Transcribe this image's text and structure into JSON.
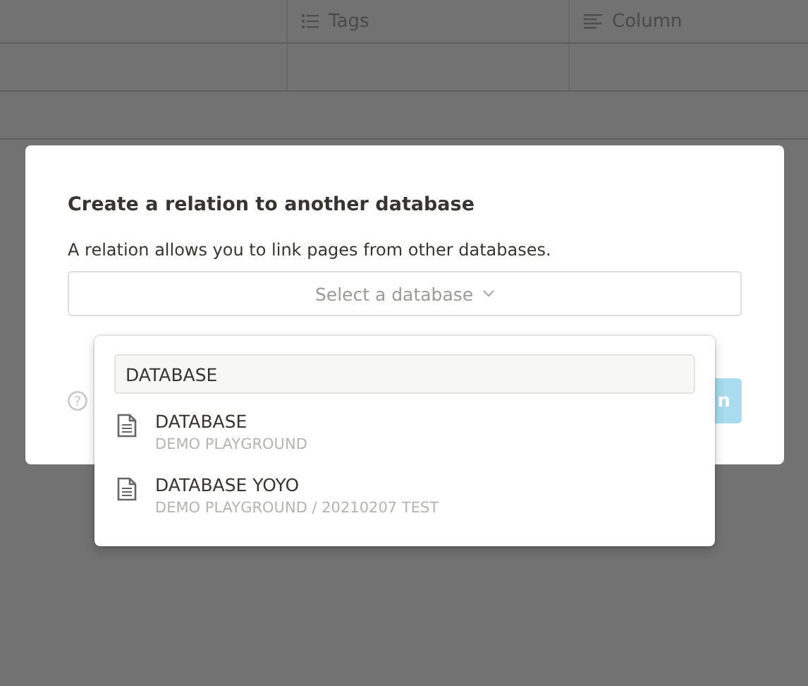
{
  "table": {
    "columns": [
      {
        "kind": "blank"
      },
      {
        "kind": "multi_select",
        "label": "Tags"
      },
      {
        "kind": "text",
        "label": "Column"
      }
    ]
  },
  "dialog": {
    "title": "Create a relation to another database",
    "description": "A relation allows you to link pages from other databases.",
    "select_placeholder": "Select a database",
    "help_glyph": "?",
    "button_label_visible": "n"
  },
  "dropdown": {
    "search_value": "DATABASE",
    "results": [
      {
        "title": "DATABASE",
        "path": "DEMO PLAYGROUND"
      },
      {
        "title": "DATABASE YOYO",
        "path": "DEMO PLAYGROUND / 20210207 TEST"
      }
    ]
  }
}
